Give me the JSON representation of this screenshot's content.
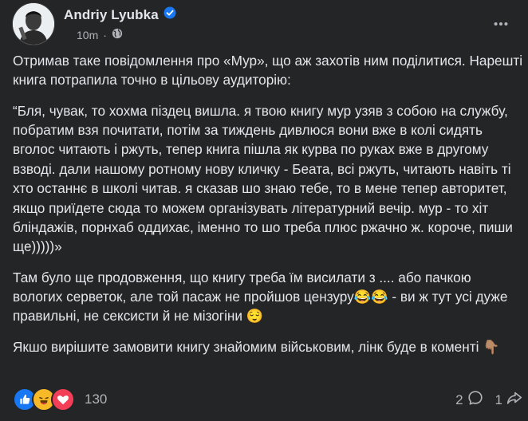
{
  "post": {
    "author": "Andriy Lyubka",
    "time": "10m",
    "separator": "·",
    "paragraphs": [
      "Отримав таке повідомлення про «Мур», що аж захотів ним поділитися. Нарешті книга потрапила точно в цільову аудиторію:",
      "“Бля, чувак, то хохма піздец вишла. я твою книгу мур узяв з собою на службу, побратим взя почитати, потім за тиждень дивлюся вони вже в колі сидять вголос читають і ржуть, тепер книга пішла як курва по руках вже в другому взводі. дали нашому ротному нову кличку - Беата, всі ржуть, читають навіть ті хто останнє в школі читав. я сказав шо знаю тебе, то в мене тепер авторитет, якщо приїдете сюда то можем організувать літературний вечір. мур - то хіт бліндажів, порнхаб оддихає, іменно то шо треба плюс ржачно ж. короче, пиши ще)))))»",
      "Там було ще продовження, що книгу треба їм висилати з .... або пачкою вологих серветок, але той пасаж не пройшов цензуру😂😂 - ви ж тут усі дуже правильні, не сексисти й не мізогіни 😌",
      "Якшо вирішите замовити книгу знайомим військовим, лінк буде в коменті 👇🏽"
    ],
    "reaction_count": "130",
    "comment_count": "2",
    "share_count": "1",
    "icons": {
      "verified": "verified-badge-icon",
      "audience": "globe-icon",
      "more": "more-options-icon",
      "reactions": [
        "like-icon",
        "haha-icon",
        "love-icon"
      ],
      "comment": "comment-icon",
      "share": "share-icon"
    },
    "colors": {
      "background": "#242526",
      "text": "#e4e6eb",
      "secondary": "#b0b3b8",
      "accent": "#1877f2"
    }
  }
}
